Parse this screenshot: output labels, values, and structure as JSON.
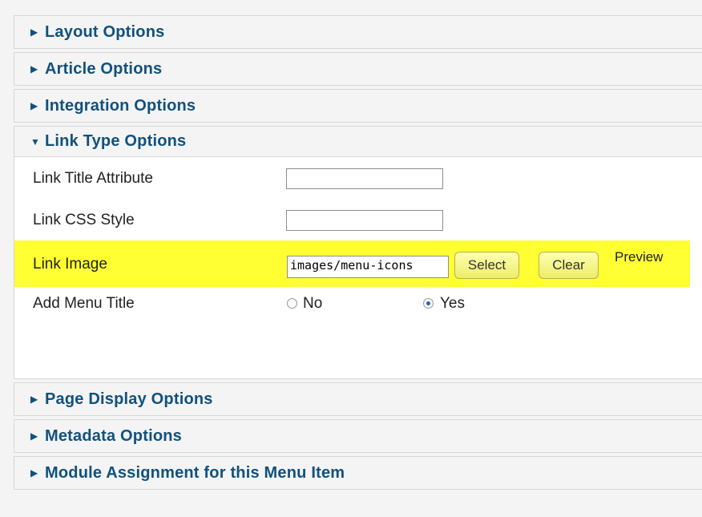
{
  "sections": {
    "layout": {
      "title": "Layout Options",
      "arrow": "▶"
    },
    "article": {
      "title": "Article Options",
      "arrow": "▶"
    },
    "integration": {
      "title": "Integration Options",
      "arrow": "▶"
    },
    "link_type": {
      "title": "Link Type Options",
      "arrow": "▼",
      "fields": {
        "link_title_label": "Link Title Attribute",
        "link_title_value": "",
        "link_css_label": "Link CSS Style",
        "link_css_value": "",
        "link_image_label": "Link Image",
        "link_image_value": "images/menu-icons",
        "select_button": "Select",
        "clear_button": "Clear",
        "preview_label": "Preview",
        "add_menu_title_label": "Add Menu Title",
        "option_no": "No",
        "option_yes": "Yes",
        "selected_option": "Yes"
      }
    },
    "page_display": {
      "title": "Page Display Options",
      "arrow": "▶"
    },
    "metadata": {
      "title": "Metadata Options",
      "arrow": "▶"
    },
    "module_assignment": {
      "title": "Module Assignment for this Menu Item",
      "arrow": "▶"
    }
  },
  "colors": {
    "header_text": "#11517e",
    "highlight": "#ffff33",
    "panel_bg": "#f4f4f4"
  }
}
